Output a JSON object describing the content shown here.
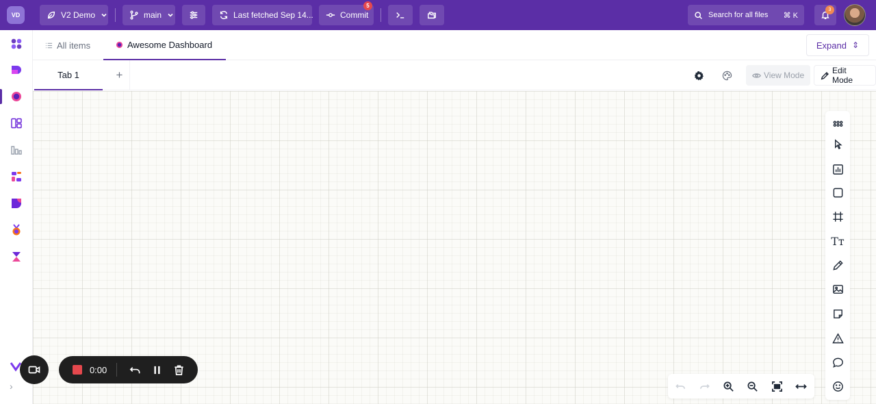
{
  "topbar": {
    "workspace_initials": "VD",
    "project_label": "V2 Demo",
    "branch_label": "main",
    "fetch_label": "Last fetched Sep 14...",
    "commit_label": "Commit",
    "commit_count": "5",
    "search_label": "Search for all files",
    "search_shortcut": "⌘ K",
    "notification_count": "3",
    "colors": {
      "bar": "#5b2ea6",
      "accent": "#5b2ea6"
    }
  },
  "rail": {
    "items": [
      {
        "name": "apps-icon"
      },
      {
        "name": "data-icon"
      },
      {
        "name": "dashboard-icon"
      },
      {
        "name": "layout-icon"
      },
      {
        "name": "chart-icon"
      },
      {
        "name": "transform-icon"
      },
      {
        "name": "model-icon"
      },
      {
        "name": "award-icon"
      },
      {
        "name": "hourglass-icon"
      }
    ]
  },
  "docbar": {
    "all_items_label": "All items",
    "active_tab_label": "Awesome Dashboard",
    "expand_label": "Expand",
    "expand_arrow": "⇕"
  },
  "subbar": {
    "tab_label": "Tab 1",
    "add_label": "+",
    "view_mode_label": "View Mode",
    "edit_mode_label": "Edit Mode"
  },
  "palette": {
    "tools": [
      "grid-dots-icon",
      "pointer-icon",
      "chart-icon",
      "rectangle-icon",
      "frame-icon",
      "text-icon",
      "pencil-icon",
      "image-icon",
      "sticky-note-icon",
      "warning-icon",
      "comment-icon",
      "emoji-icon"
    ],
    "text_tool_glyph": "Tт"
  },
  "zoombar": {
    "tools": [
      "undo-icon",
      "redo-icon",
      "zoom-in-icon",
      "zoom-out-icon",
      "fit-screen-icon",
      "fit-width-icon"
    ]
  },
  "recorder": {
    "time": "0:00"
  }
}
